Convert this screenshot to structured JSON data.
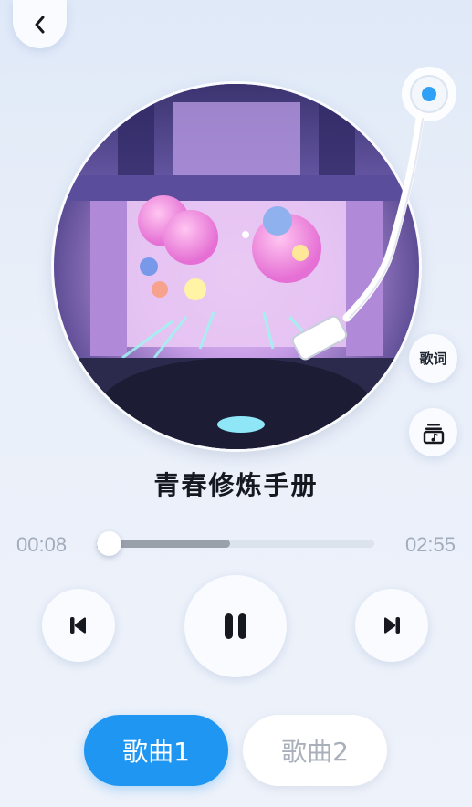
{
  "header": {
    "back_icon": "chevron-left-icon"
  },
  "album": {
    "art_icon": "concert-stage-album-art"
  },
  "side_buttons": {
    "lyrics_label": "歌词",
    "playlist_icon": "music-playlist-icon"
  },
  "song": {
    "title": "青春修炼手册"
  },
  "progress": {
    "current": "00:08",
    "total": "02:55",
    "fraction": 0.046,
    "buffered_fraction": 0.48
  },
  "controls": {
    "prev_icon": "skip-previous-icon",
    "play_icon": "pause-icon",
    "next_icon": "skip-next-icon"
  },
  "tabs": [
    {
      "label": "歌曲1",
      "active": true
    },
    {
      "label": "歌曲2",
      "active": false
    }
  ],
  "colors": {
    "accent": "#1e96f2",
    "text_primary": "#15181f",
    "text_muted": "#a2acbc",
    "progress_played": "#9aa1ab",
    "progress_track": "#dde3ec"
  }
}
